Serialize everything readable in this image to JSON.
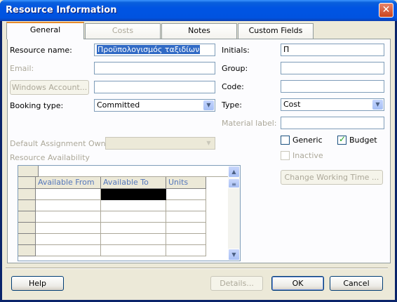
{
  "window": {
    "title": "Resource Information",
    "close_glyph": "✕"
  },
  "tabs": [
    {
      "label": "General",
      "active": true,
      "enabled": true
    },
    {
      "label": "Costs",
      "active": false,
      "enabled": false
    },
    {
      "label": "Notes",
      "active": false,
      "enabled": true
    },
    {
      "label": "Custom Fields",
      "active": false,
      "enabled": true
    }
  ],
  "general": {
    "resource_name": {
      "label": "Resource name:",
      "value": "Προϋπολογισμός ταξιδίων"
    },
    "email": {
      "label": "Email:",
      "value": ""
    },
    "windows_account": {
      "label": "Windows Account...",
      "value": ""
    },
    "booking_type": {
      "label": "Booking type:",
      "value": "Committed"
    },
    "initials": {
      "label": "Initials:",
      "value": "Π"
    },
    "group": {
      "label": "Group:",
      "value": ""
    },
    "code": {
      "label": "Code:",
      "value": ""
    },
    "type": {
      "label": "Type:",
      "value": "Cost"
    },
    "material_label": {
      "label": "Material label:",
      "value": ""
    },
    "generic": {
      "label": "Generic",
      "checked": false
    },
    "budget": {
      "label": "Budget",
      "checked": true
    },
    "inactive": {
      "label": "Inactive",
      "checked": false,
      "enabled": false
    },
    "default_assignment_owner": {
      "label": "Default Assignment Owner:",
      "value": ""
    },
    "resource_availability": {
      "label": "Resource Availability",
      "columns": [
        "Available From",
        "Available To",
        "Units"
      ],
      "rows": [
        [
          "",
          "",
          ""
        ],
        [
          "",
          "",
          ""
        ],
        [
          "",
          "",
          ""
        ],
        [
          "",
          "",
          ""
        ],
        [
          "",
          "",
          ""
        ],
        [
          "",
          "",
          ""
        ]
      ]
    },
    "change_working_time_label": "Change Working Time ..."
  },
  "buttons": {
    "help": "Help",
    "details": "Details...",
    "ok": "OK",
    "cancel": "Cancel"
  },
  "colors": {
    "titlebar": "#0054e3",
    "disabled_text": "#aca899",
    "active_tab_accent": "#e68b2c",
    "budget_check": "#21a121"
  }
}
